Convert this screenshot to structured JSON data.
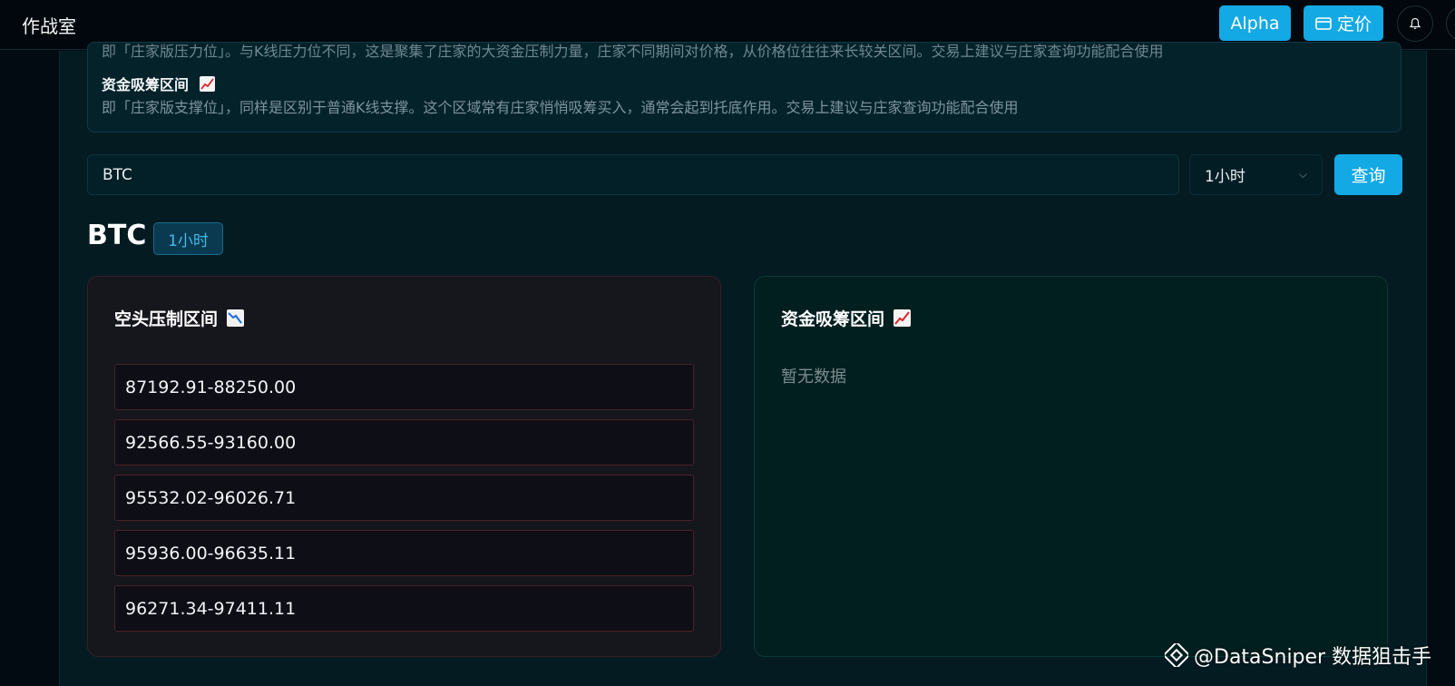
{
  "header": {
    "app_title": "作战室",
    "alpha_label": "Alpha",
    "pricing_label": "定价"
  },
  "info": {
    "cut_text": "即「庄家版压力位」。与K线压力位不同，这是聚集了庄家的大资金压制力量，庄家不同期间对价格，从价格位往往来长较关区间。交易上建议与庄家查询功能配合使用",
    "absorb_title": "资金吸筹区间",
    "absorb_desc": "即「庄家版支撑位」，同样是区别于普通K线支撑。这个区域常有庄家悄悄吸筹买入，通常会起到托底作用。交易上建议与庄家查询功能配合使用"
  },
  "search": {
    "value": "BTC",
    "interval": "1小时",
    "query_label": "查询"
  },
  "result": {
    "symbol": "BTC",
    "interval_badge": "1小时",
    "short_panel": {
      "title": "空头压制区间",
      "zones": [
        "87192.91-88250.00",
        "92566.55-93160.00",
        "95532.02-96026.71",
        "95936.00-96635.11",
        "96271.34-97411.11"
      ]
    },
    "long_panel": {
      "title": "资金吸筹区间",
      "empty_text": "暂无数据"
    }
  },
  "watermark": {
    "handle": "@DataSniper 数据狙击手"
  }
}
